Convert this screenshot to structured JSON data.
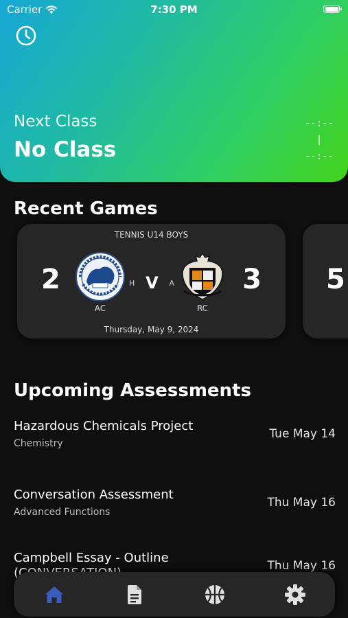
{
  "status_bar": {
    "carrier": "Carrier",
    "time": "7:30 PM",
    "battery_level": 1.0
  },
  "hero": {
    "gradient_colors": [
      "#16a8d6",
      "#2fcf63",
      "#43d31a"
    ],
    "label": "Next Class",
    "value": "No Class",
    "time_start": "--:--",
    "time_separator": "|",
    "time_end": "--:--"
  },
  "recent_games": {
    "title": "Recent Games",
    "games": [
      {
        "sport": "TENNIS U14 BOYS",
        "home_score": "2",
        "away_score": "3",
        "home_team": "AC",
        "away_team": "RC",
        "home_marker": "H",
        "vs": "V",
        "away_marker": "A",
        "date": "Thursday, May 9, 2024"
      },
      {
        "home_score": "5"
      }
    ]
  },
  "assessments": {
    "title": "Upcoming Assessments",
    "items": [
      {
        "title": "Hazardous Chemicals Project",
        "subject": "Chemistry",
        "date": "Tue May 14"
      },
      {
        "title": "Conversation Assessment",
        "subject": "Advanced Functions",
        "date": "Thu May 16"
      },
      {
        "title": "Campbell Essay - Outline",
        "subtitle2": "(CONVERSATION)",
        "date": "Thu May 16"
      }
    ]
  },
  "tabbar": {
    "active_color": "#3b5cb8",
    "inactive_color": "#e0e0e0",
    "tabs": [
      {
        "icon": "home-icon",
        "active": true
      },
      {
        "icon": "document-icon",
        "active": false
      },
      {
        "icon": "basketball-icon",
        "active": false
      },
      {
        "icon": "gear-icon",
        "active": false
      }
    ]
  }
}
